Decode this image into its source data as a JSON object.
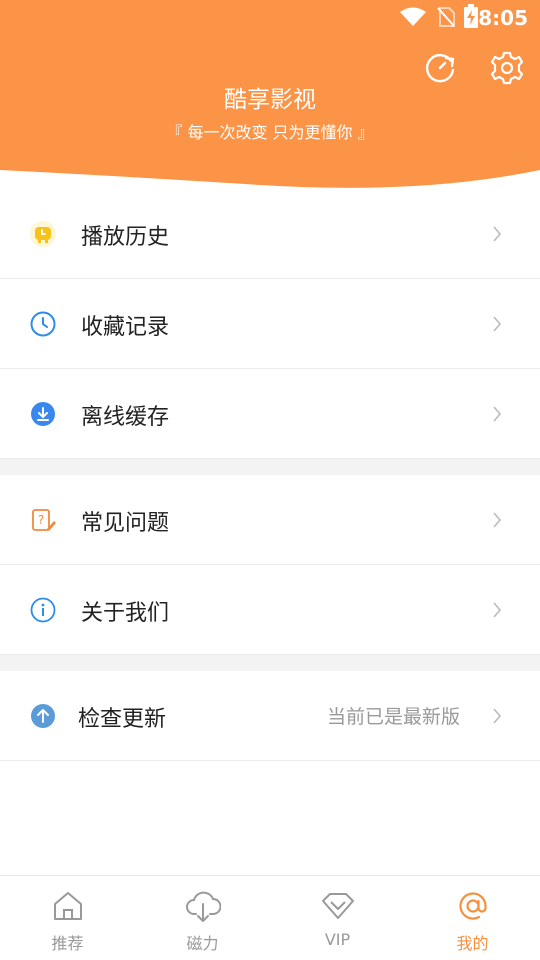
{
  "status": {
    "time": "8:05"
  },
  "header": {
    "title": "酷享影视",
    "slogan": "『 每一次改变  只为更懂你 』",
    "bg_color": "#fb9447"
  },
  "menu_groups": [
    [
      {
        "label": "播放历史",
        "icon": "play-history-icon"
      },
      {
        "label": "收藏记录",
        "icon": "clock-icon"
      },
      {
        "label": "离线缓存",
        "icon": "download-icon"
      }
    ],
    [
      {
        "label": "常见问题",
        "icon": "faq-icon"
      },
      {
        "label": "关于我们",
        "icon": "info-icon"
      }
    ],
    [
      {
        "label": "检查更新",
        "icon": "update-arrow-icon",
        "value": "当前已是最新版"
      }
    ]
  ],
  "tabs": [
    {
      "label": "推荐",
      "icon": "home-icon",
      "active": false
    },
    {
      "label": "磁力",
      "icon": "cloud-download-icon",
      "active": false
    },
    {
      "label": "VIP",
      "icon": "diamond-icon",
      "active": false
    },
    {
      "label": "我的",
      "icon": "at-icon",
      "active": true
    }
  ],
  "colors": {
    "accent": "#f5913e",
    "inactive": "#999999",
    "blue": "#2e8de6"
  }
}
